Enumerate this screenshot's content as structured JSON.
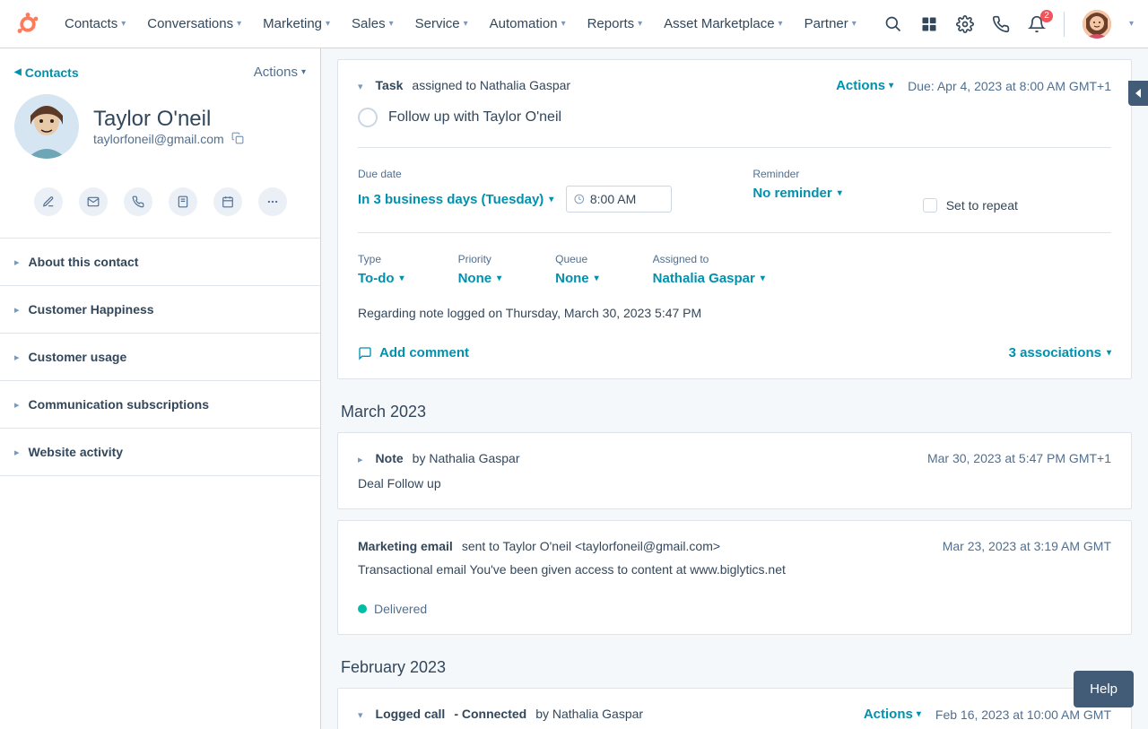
{
  "nav": {
    "items": [
      {
        "label": "Contacts"
      },
      {
        "label": "Conversations"
      },
      {
        "label": "Marketing"
      },
      {
        "label": "Sales"
      },
      {
        "label": "Service"
      },
      {
        "label": "Automation"
      },
      {
        "label": "Reports"
      },
      {
        "label": "Asset Marketplace"
      },
      {
        "label": "Partner"
      }
    ],
    "notification_count": "2"
  },
  "sidebar": {
    "back_label": "Contacts",
    "actions_label": "Actions",
    "contact_name": "Taylor O'neil",
    "contact_email": "taylorfoneil@gmail.com",
    "sections": [
      "About this contact",
      "Customer Happiness",
      "Customer usage",
      "Communication subscriptions",
      "Website activity"
    ]
  },
  "task_card": {
    "type_label": "Task",
    "assigned_text": "assigned to Nathalia Gaspar",
    "actions_label": "Actions",
    "due_text": "Due: Apr 4, 2023 at 8:00 AM GMT+1",
    "title": "Follow up with Taylor O'neil",
    "due_date_label": "Due date",
    "due_date_value": "In 3 business days (Tuesday)",
    "time_value": "8:00 AM",
    "reminder_label": "Reminder",
    "reminder_value": "No reminder",
    "repeat_label": "Set to repeat",
    "type_field_label": "Type",
    "type_field_value": "To-do",
    "priority_label": "Priority",
    "priority_value": "None",
    "queue_label": "Queue",
    "queue_value": "None",
    "assigned_label": "Assigned to",
    "assigned_value": "Nathalia Gaspar",
    "regarding_text": "Regarding note logged on Thursday, March 30, 2023 5:47 PM",
    "add_comment_label": "Add comment",
    "associations_label": "3 associations"
  },
  "month_march": "March 2023",
  "note_card": {
    "type_label": "Note",
    "by_text": "by Nathalia Gaspar",
    "timestamp": "Mar 30, 2023 at 5:47 PM GMT+1",
    "body": "Deal Follow up"
  },
  "email_card": {
    "type_label": "Marketing email",
    "meta": "sent to Taylor O'neil <taylorfoneil@gmail.com>",
    "timestamp": "Mar 23, 2023 at 3:19 AM GMT",
    "body": "Transactional email You've been given access to content at www.biglytics.net",
    "delivered_label": "Delivered"
  },
  "month_feb": "February 2023",
  "call_card": {
    "type_label": "Logged call",
    "status": "- Connected",
    "by_text": "by Nathalia Gaspar",
    "actions_label": "Actions",
    "timestamp": "Feb 16, 2023 at 10:00 AM GMT"
  },
  "help_label": "Help"
}
